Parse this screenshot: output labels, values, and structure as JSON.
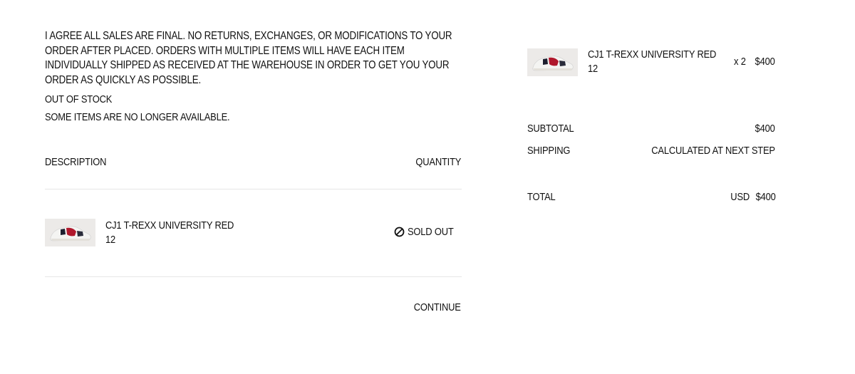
{
  "checkout": {
    "agreement_text": "I AGREE ALL SALES ARE FINAL. NO RETURNS, EXCHANGES, OR MODIFICATIONS TO YOUR ORDER AFTER PLACED. ORDERS WITH MULTIPLE ITEMS WILL HAVE EACH ITEM INDIVIDUALLY SHIPPED AS RECEIVED AT THE WAREHOUSE IN ORDER TO GET YOU YOUR ORDER AS QUICKLY AS POSSIBLE.",
    "stock_notice": {
      "title": "OUT OF STOCK",
      "message": "SOME ITEMS ARE NO LONGER AVAILABLE."
    },
    "table": {
      "description_header": "DESCRIPTION",
      "quantity_header": "QUANTITY",
      "items": [
        {
          "name": "CJ1 T-REXX UNIVERSITY RED",
          "size": "12",
          "status": "SOLD OUT",
          "status_icon": "prohibited-icon"
        }
      ]
    },
    "continue_label": "CONTINUE"
  },
  "summary": {
    "items": [
      {
        "name": "CJ1 T-REXX UNIVERSITY RED",
        "size": "12",
        "quantity": "x 2",
        "price": "$400"
      }
    ],
    "subtotal_label": "SUBTOTAL",
    "subtotal_value": "$400",
    "shipping_label": "SHIPPING",
    "shipping_value": "CALCULATED AT NEXT STEP",
    "total_label": "TOTAL",
    "currency": "USD",
    "total_value": "$400"
  },
  "colors": {
    "text": "#111111",
    "divider": "#e6e6e6",
    "thumbnail_bg": "#eceae8",
    "shoe_accent": "#b0182c"
  }
}
